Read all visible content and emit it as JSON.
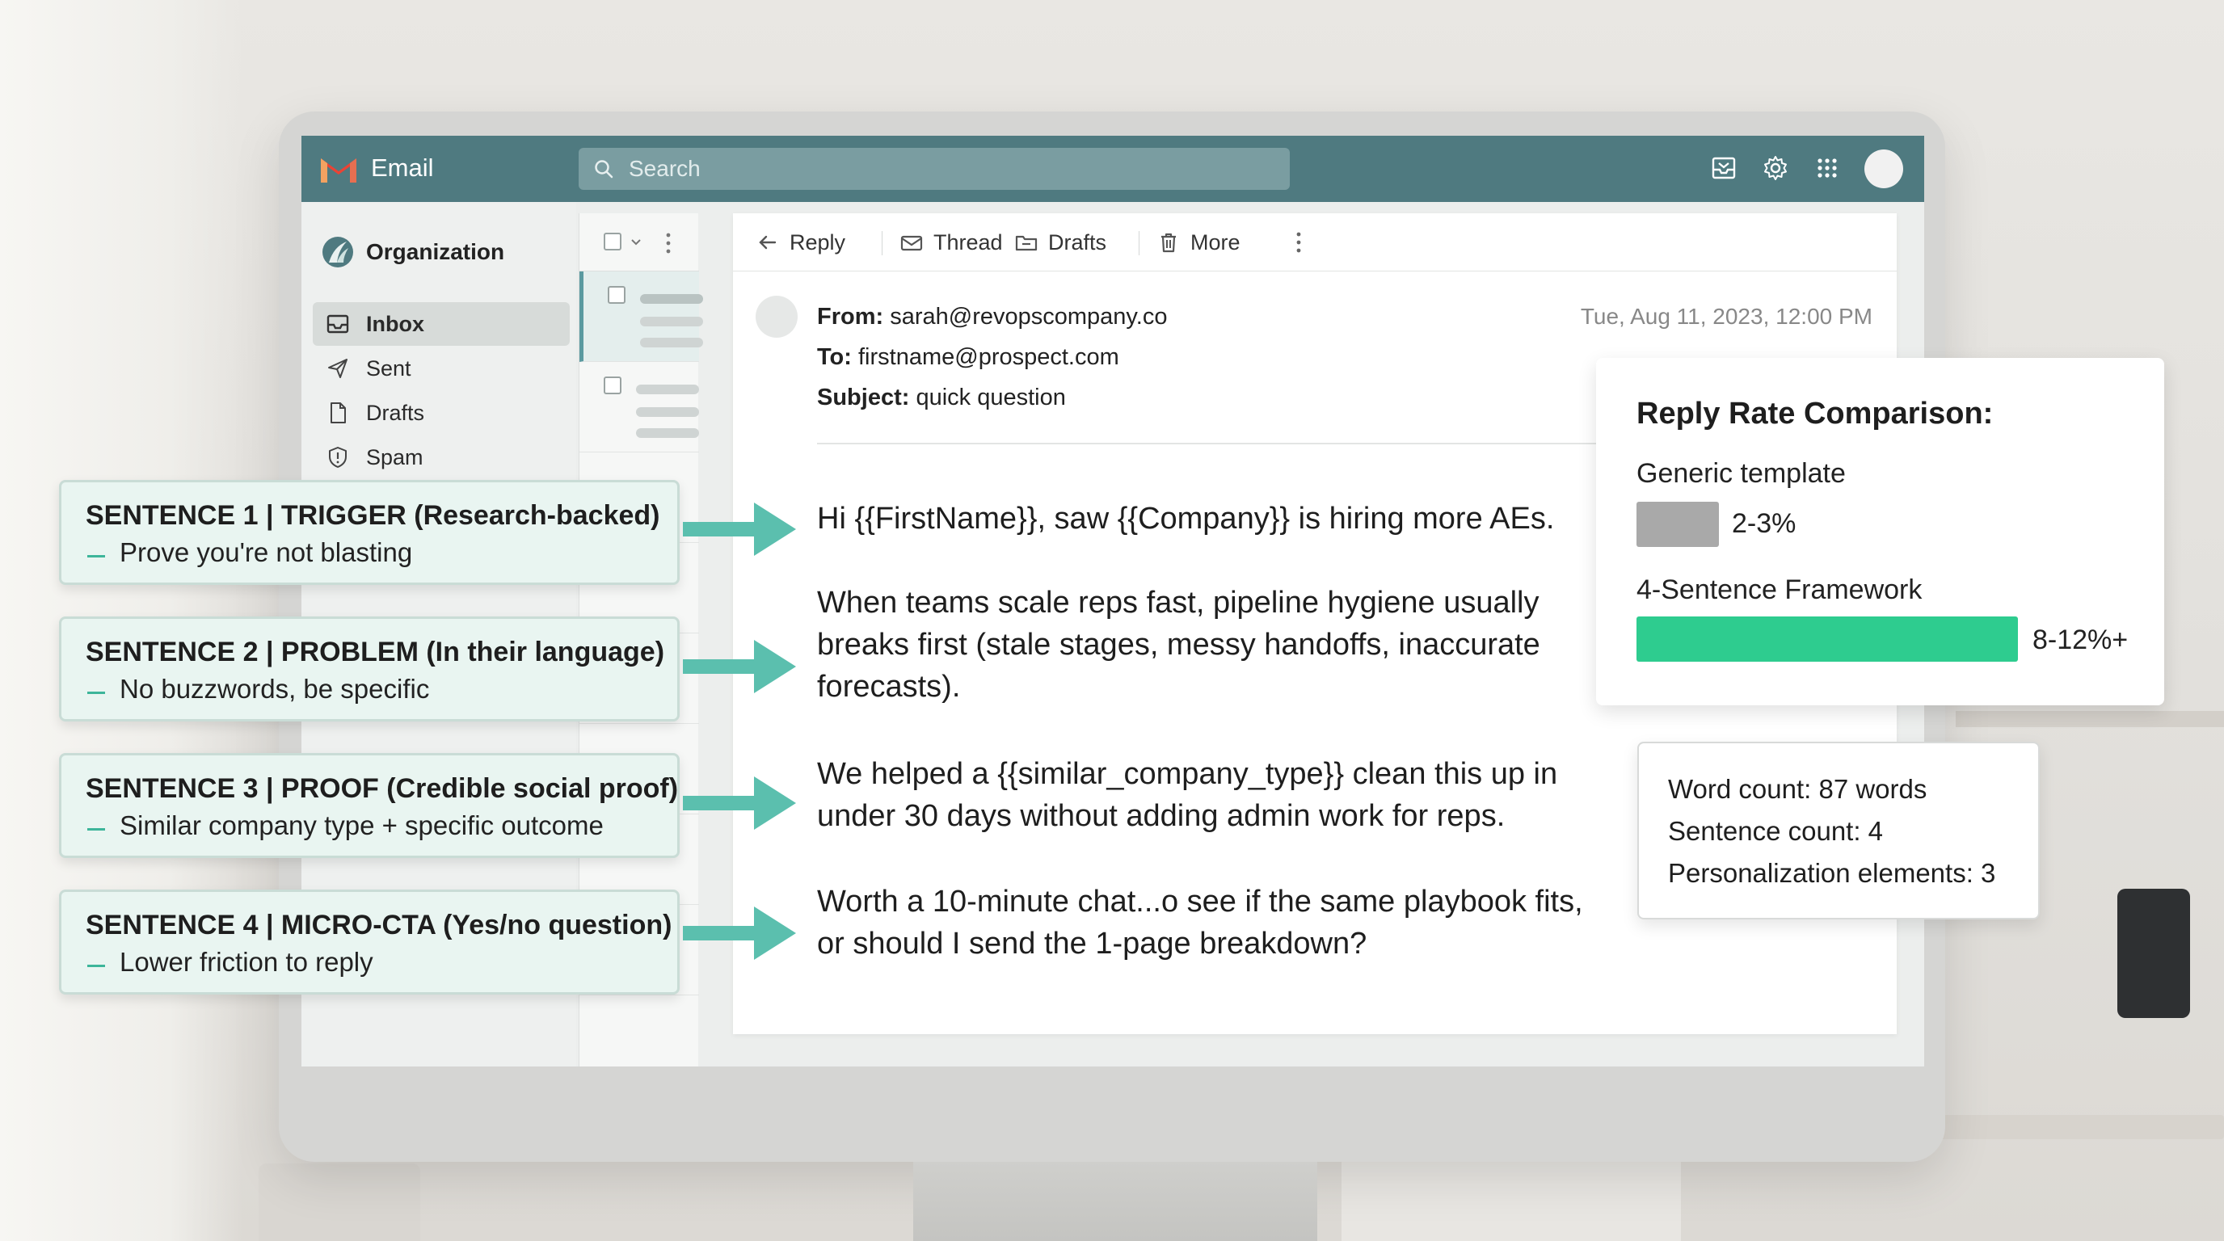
{
  "app": {
    "title": "Email",
    "search_placeholder": "Search",
    "accent_color": "#4f7a80"
  },
  "topbar_icons": [
    "inbox-tray-icon",
    "gear-icon",
    "apps-grid-icon",
    "avatar"
  ],
  "sidebar": {
    "org_label": "Organization",
    "items": [
      {
        "label": "Inbox",
        "icon": "inbox-icon",
        "active": true
      },
      {
        "label": "Sent",
        "icon": "send-icon",
        "active": false
      },
      {
        "label": "Drafts",
        "icon": "file-icon",
        "active": false
      },
      {
        "label": "Spam",
        "icon": "shield-icon",
        "active": false
      }
    ]
  },
  "toolbar": {
    "reply_label": "Reply",
    "thread_label": "Thread",
    "drafts_label": "Drafts",
    "more_label": "More"
  },
  "email": {
    "from_label": "From:",
    "from": "sarah@revopscompany.co",
    "to_label": "To:",
    "to": "firstname@prospect.com",
    "subject_label": "Subject:",
    "subject": "quick question",
    "date": "Tue, Aug 11, 2023, 12:00 PM",
    "paragraphs": [
      "Hi {{FirstName}}, saw {{Company}} is hiring more AEs.",
      "When teams scale reps fast, pipeline hygiene usually breaks first (stale stages, messy handoffs, inaccurate forecasts).",
      "We helped a {{similar_company_type}} clean this up in under 30 days without adding admin work for reps.",
      "Worth a 10-minute chat...o see if the same playbook fits, or should I send the 1-page breakdown?"
    ]
  },
  "callouts": [
    {
      "title": "SENTENCE 1 | TRIGGER (Research-backed)",
      "sub": "Prove you're not blasting"
    },
    {
      "title": "SENTENCE 2 | PROBLEM (In their language)",
      "sub": "No buzzwords, be specific"
    },
    {
      "title": "SENTENCE 3 | PROOF (Credible social proof)",
      "sub": "Similar company type + specific outcome"
    },
    {
      "title": "SENTENCE 4 | MICRO-CTA (Yes/no question)",
      "sub": "Lower friction to reply"
    }
  ],
  "reply_rate": {
    "title": "Reply Rate Comparison:",
    "generic_label": "Generic template",
    "generic_value": "2-3%",
    "generic_color": "#a9a9a9",
    "framework_label": "4-Sentence Framework",
    "framework_value": "8-12%+",
    "framework_color": "#2ecc8f"
  },
  "stats": {
    "word_count": "Word count: 87 words",
    "sentence_count": "Sentence count: 4",
    "personalization": "Personalization elements: 3"
  },
  "callout_accent": "#5bbfae"
}
